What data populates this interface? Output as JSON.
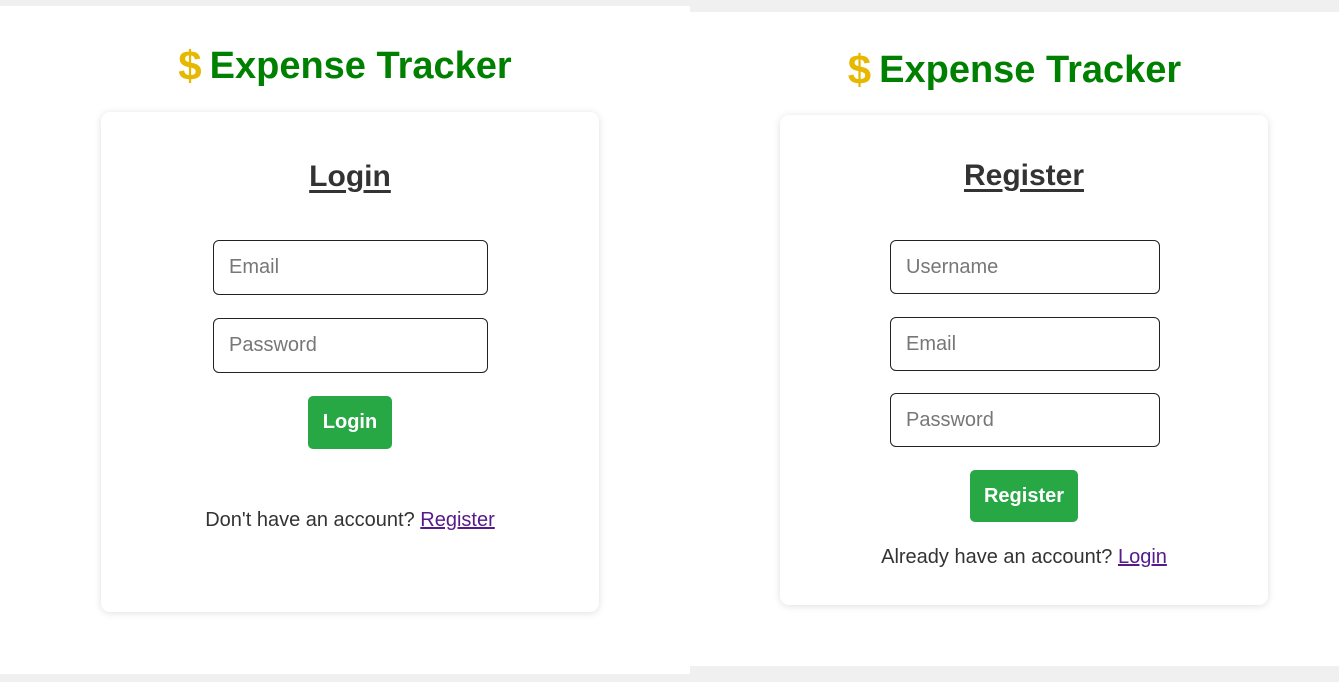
{
  "app": {
    "title": "Expense Tracker",
    "logo_icon": "dollar-icon",
    "logo_glyph": "$"
  },
  "colors": {
    "title_green": "#008000",
    "dollar_gold": "#e6b800",
    "button_green": "#28a745",
    "link_visited": "#551a8b"
  },
  "login": {
    "heading": "Login",
    "fields": {
      "email_placeholder": "Email",
      "password_placeholder": "Password"
    },
    "submit_label": "Login",
    "footer_prompt": "Don't have an account?",
    "footer_link": "Register"
  },
  "register": {
    "heading": "Register",
    "fields": {
      "username_placeholder": "Username",
      "email_placeholder": "Email",
      "password_placeholder": "Password"
    },
    "submit_label": "Register",
    "footer_prompt": "Already have an account?",
    "footer_link": "Login"
  }
}
